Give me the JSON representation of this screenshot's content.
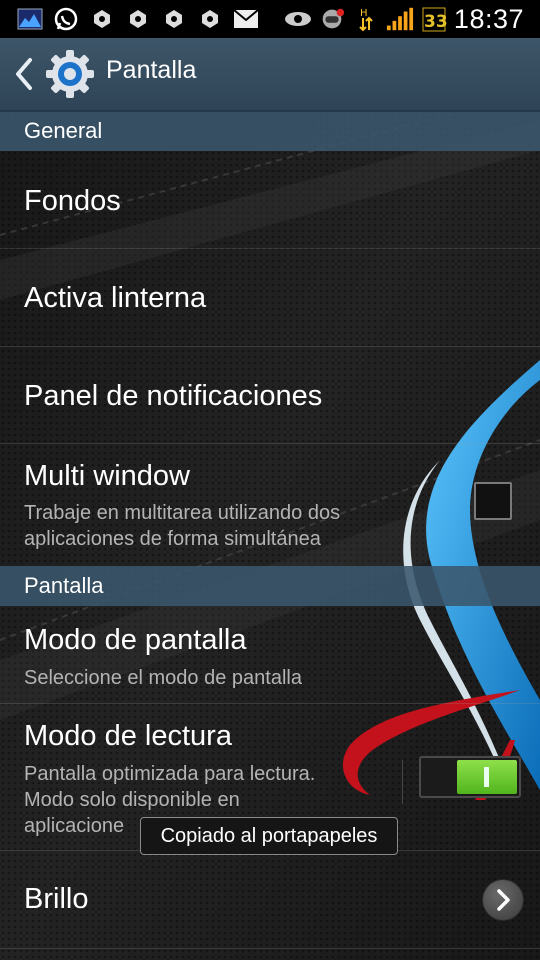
{
  "status_bar": {
    "time": "18:37",
    "icons_left": [
      "gallery-icon",
      "whatsapp-icon",
      "puzzle-icon",
      "puzzle-icon",
      "puzzle-icon",
      "puzzle-icon",
      "email-icon"
    ],
    "icons_right": [
      "eye-icon",
      "gamepad-icon",
      "data-transfer-icon",
      "signal-icon",
      "battery-icon"
    ]
  },
  "action_bar": {
    "title": "Pantalla"
  },
  "sections": {
    "general": "General",
    "pantalla": "Pantalla"
  },
  "rows": {
    "fondos": {
      "title": "Fondos"
    },
    "linterna": {
      "title": "Activa linterna"
    },
    "notificaciones": {
      "title": "Panel de notificaciones"
    },
    "multi_window": {
      "title": "Multi window",
      "subtitle_line1": "Trabaje en multitarea utilizando dos",
      "subtitle_line2": "aplicaciones de forma simultánea",
      "checked": false
    },
    "modo_pantalla": {
      "title": "Modo de pantalla",
      "subtitle": "Seleccione el modo de pantalla"
    },
    "modo_lectura": {
      "title": "Modo de lectura",
      "subtitle_line1": "Pantalla optimizada para lectura.",
      "subtitle_line2": "Modo solo disponible en",
      "subtitle_line3": "aplicacione",
      "enabled": true
    },
    "brillo": {
      "title": "Brillo"
    }
  },
  "toast": "Copiado al portapapeles",
  "colors": {
    "accent_blue": "#1b8fd8",
    "header_blue": "#3a566c",
    "toggle_green": "#6bcc2e"
  }
}
